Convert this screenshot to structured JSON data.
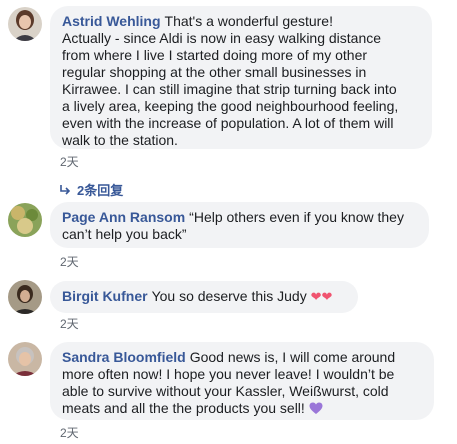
{
  "comments": [
    {
      "author": "Astrid Wehling",
      "lines": [
        "That's a wonderful gesture!",
        "Actually - since Aldi is now in easy walking distance",
        "from where I live I started doing more of my other",
        "regular shopping at the other small businesses in",
        "Kirrawee. I can still imagine that strip turning back into",
        "a lively area, keeping the good neighbourhood feeling,",
        "even with the increase of population. A lot of them will",
        "walk to the station."
      ],
      "time": "2天",
      "replies_label": "2条回复"
    },
    {
      "author": "Page Ann Ransom",
      "lines": [
        "“Help others even if you know they",
        "can’t help you back”"
      ],
      "time": "2天"
    },
    {
      "author": "Birgit Kufner",
      "lines": [
        "You so deserve this Judy"
      ],
      "emoji": "❤❤",
      "time": "2天"
    },
    {
      "author": "Sandra Bloomfield",
      "lines": [
        "Good news is, I will come around",
        "more often now! I hope you never leave! I wouldn’t be",
        "able to survive without your Kassler, Weißwurst, cold",
        "meats and all the the products you sell!"
      ],
      "emoji": "purple-heart",
      "time": "2天"
    }
  ]
}
